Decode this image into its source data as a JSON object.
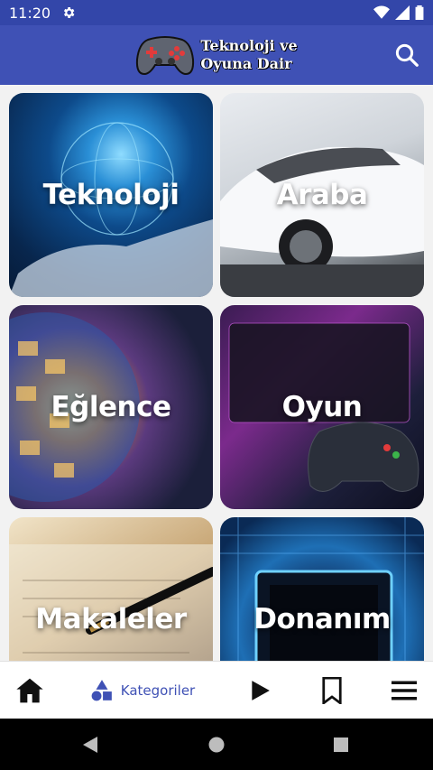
{
  "status": {
    "time": "11:20"
  },
  "app": {
    "title_line1": "Teknoloji ve",
    "title_line2": "Oyuna Dair"
  },
  "tiles": [
    {
      "label": "Teknoloji"
    },
    {
      "label": "Araba"
    },
    {
      "label": "Eğlence"
    },
    {
      "label": "Oyun"
    },
    {
      "label": "Makaleler"
    },
    {
      "label": "Donanım"
    }
  ],
  "bottom_nav": {
    "categories_label": "Kategoriler"
  },
  "colors": {
    "primary": "#3f51b5",
    "status_bar": "#3346a9",
    "nav_active": "#3f51b5"
  }
}
